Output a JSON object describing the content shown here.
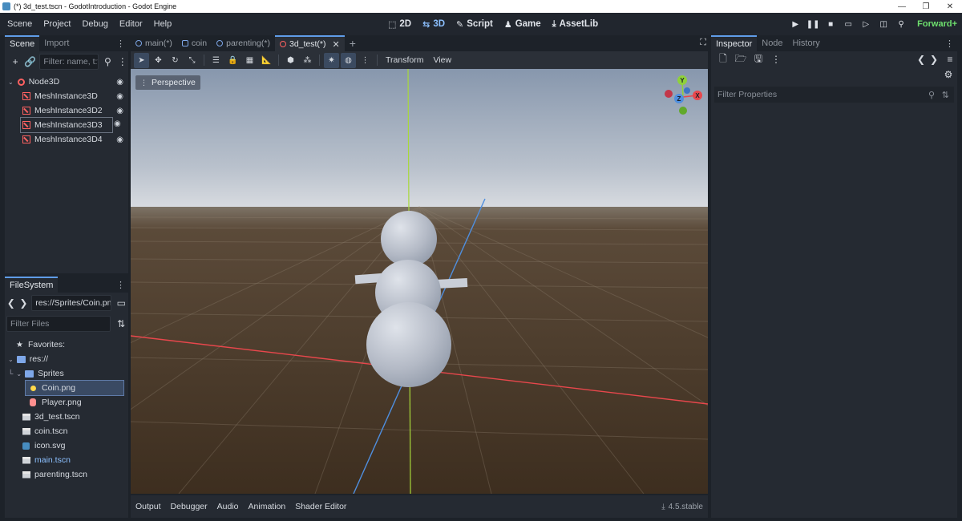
{
  "window": {
    "title": "(*) 3d_test.tscn - GodotIntroduction - Godot Engine",
    "controls": [
      "—",
      "❐",
      "✕"
    ]
  },
  "menus": [
    "Scene",
    "Project",
    "Debug",
    "Editor",
    "Help"
  ],
  "main_tabs": [
    {
      "label": "2D",
      "icon": "2d-icon"
    },
    {
      "label": "3D",
      "icon": "3d-icon"
    },
    {
      "label": "Script",
      "icon": "script-icon"
    },
    {
      "label": "Game",
      "icon": "game-icon"
    },
    {
      "label": "AssetLib",
      "icon": "assetlib-icon"
    }
  ],
  "renderer": "Forward+",
  "scene_dock": {
    "tabs": [
      "Scene",
      "Import"
    ],
    "filter_placeholder": "Filter: name, t:typ",
    "tree": [
      "Node3D",
      "MeshInstance3D",
      "MeshInstance3D2",
      "MeshInstance3D3",
      "MeshInstance3D4"
    ]
  },
  "filesystem": {
    "tab": "FileSystem",
    "path": "res://Sprites/Coin.png",
    "filter_placeholder": "Filter Files",
    "favorites": "Favorites:",
    "root": "res://",
    "sprites_folder": "Sprites",
    "files": [
      "Coin.png",
      "Player.png",
      "3d_test.tscn",
      "coin.tscn",
      "icon.svg",
      "main.tscn",
      "parenting.tscn"
    ]
  },
  "editor_tabs": [
    "main(*)",
    "coin",
    "parenting(*)",
    "3d_test(*)"
  ],
  "viewport_toolbar": {
    "transform": "Transform",
    "view": "View"
  },
  "viewport": {
    "perspective": "Perspective",
    "gizmo": {
      "y": "Y",
      "z": "Z",
      "x": "X"
    }
  },
  "bottom_panel": {
    "tabs": [
      "Output",
      "Debugger",
      "Audio",
      "Animation",
      "Shader Editor"
    ],
    "version": "4.5.stable"
  },
  "inspector": {
    "tabs": [
      "Inspector",
      "Node",
      "History"
    ],
    "filter_placeholder": "Filter Properties"
  },
  "colors": {
    "accent": "#5f9ce8",
    "node3d": "#ff6161",
    "renderer": "#6ee06e",
    "x_axis": "#e8474c",
    "y_axis": "#8fd13a",
    "z_axis": "#4f8fdf"
  }
}
